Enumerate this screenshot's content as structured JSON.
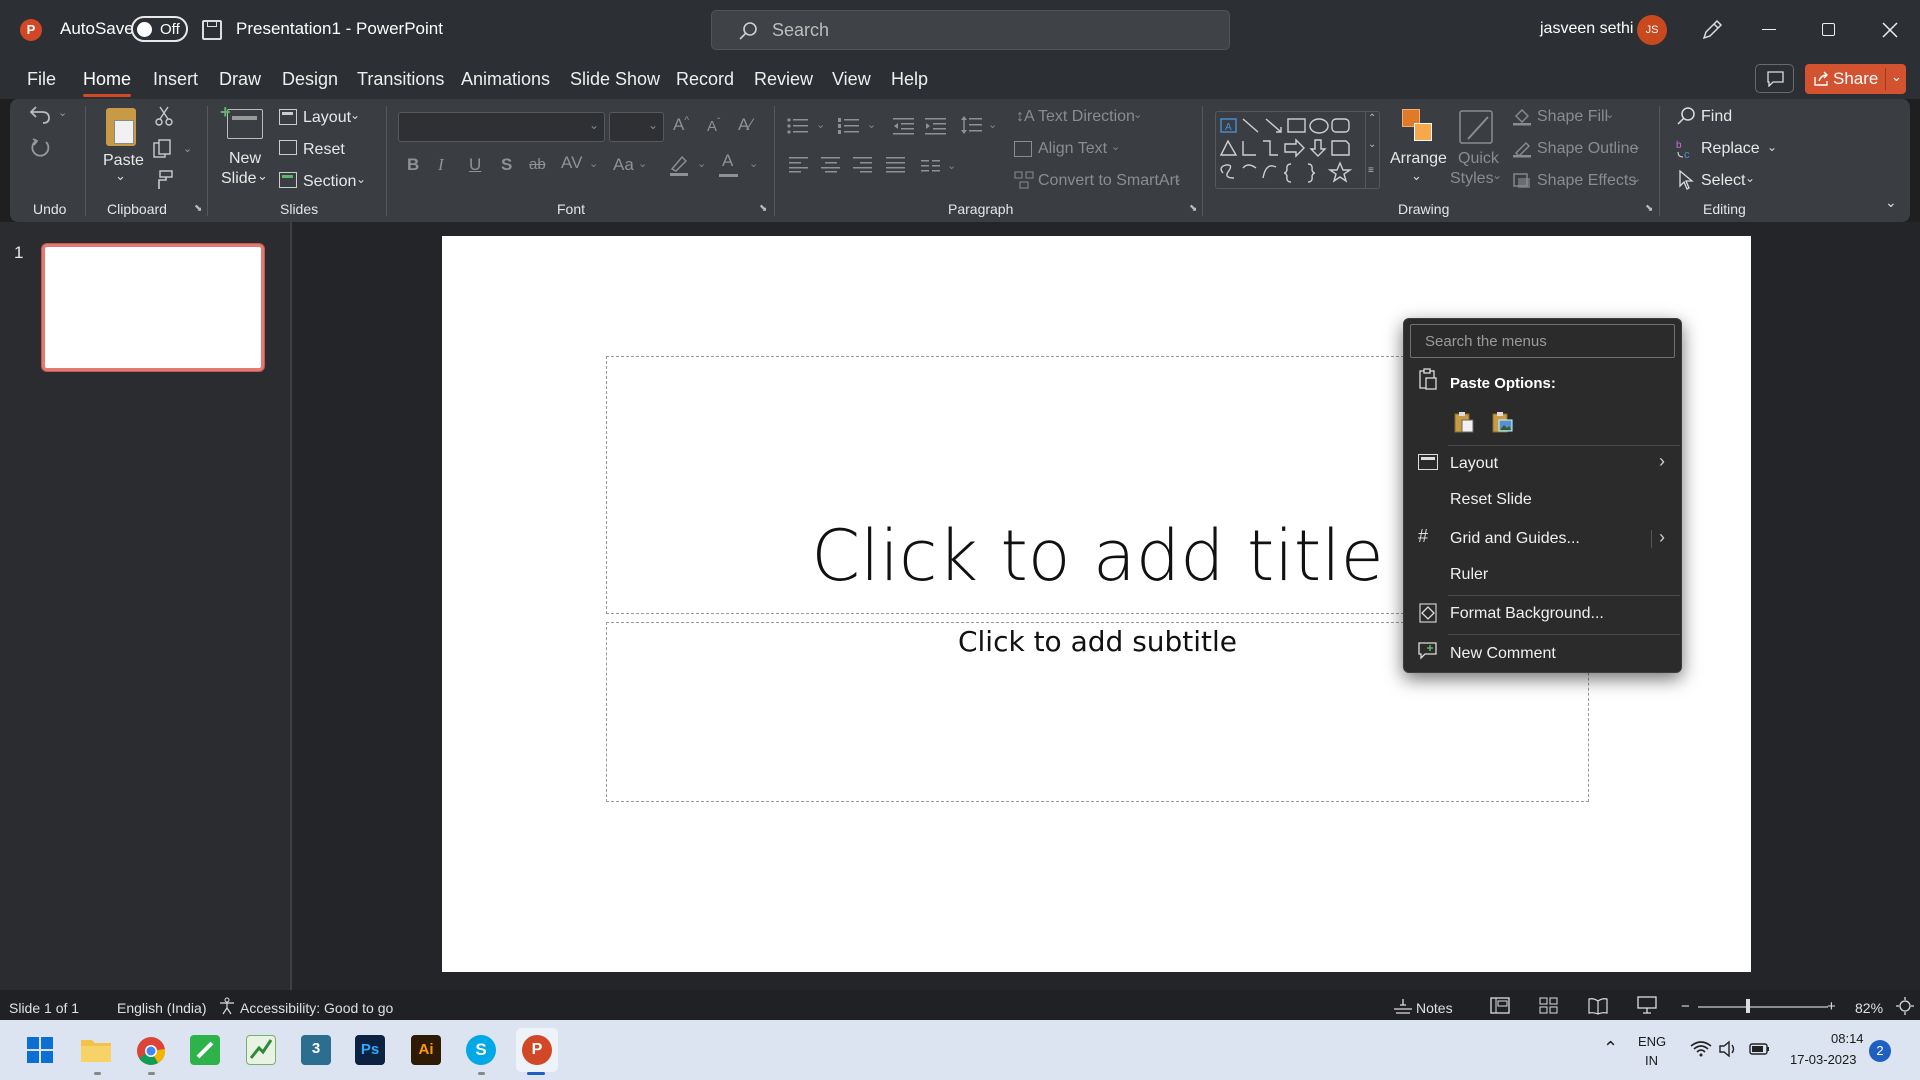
{
  "titlebar": {
    "autosave_label": "AutoSave",
    "autosave_state": "Off",
    "doc_title": "Presentation1  -  PowerPoint",
    "search_placeholder": "Search",
    "user_name": "jasveen sethi",
    "user_initials": "JS"
  },
  "menu": {
    "tabs": [
      "File",
      "Home",
      "Insert",
      "Draw",
      "Design",
      "Transitions",
      "Animations",
      "Slide Show",
      "Record",
      "Review",
      "View",
      "Help"
    ],
    "active_tab": "Home",
    "share_label": "Share"
  },
  "ribbon": {
    "groups": {
      "undo": "Undo",
      "clipboard": "Clipboard",
      "slides": "Slides",
      "font": "Font",
      "paragraph": "Paragraph",
      "drawing": "Drawing",
      "editing": "Editing"
    },
    "paste_label": "Paste",
    "new_slide_label_1": "New",
    "new_slide_label_2": "Slide",
    "layout_label": "Layout",
    "reset_label": "Reset",
    "section_label": "Section",
    "text_direction_label": "Text Direction",
    "align_text_label": "Align Text",
    "convert_smartart_label": "Convert to SmartArt",
    "arrange_label": "Arrange",
    "quick_styles_label_1": "Quick",
    "quick_styles_label_2": "Styles",
    "shape_fill_label": "Shape Fill",
    "shape_outline_label": "Shape Outline",
    "shape_effects_label": "Shape Effects",
    "find_label": "Find",
    "replace_label": "Replace",
    "select_label": "Select",
    "font_buttons": [
      "B",
      "I",
      "U",
      "S",
      "ab",
      "AV",
      "Aa"
    ]
  },
  "slides_pane": {
    "slide_number": "1"
  },
  "slide": {
    "title_placeholder": "Click to add title",
    "subtitle_placeholder": "Click to add subtitle"
  },
  "context_menu": {
    "search_placeholder": "Search the menus",
    "paste_options_label": "Paste Options:",
    "items": [
      "Layout",
      "Reset Slide",
      "Grid and Guides...",
      "Ruler",
      "Format Background...",
      "New Comment"
    ]
  },
  "statusbar": {
    "slide_count": "Slide 1 of 1",
    "language": "English (India)",
    "accessibility": "Accessibility: Good to go",
    "notes_label": "Notes",
    "zoom": "82%"
  },
  "taskbar": {
    "lang_1": "ENG",
    "lang_2": "IN",
    "time": "08:14",
    "date": "17-03-2023",
    "notification_count": "2",
    "app_labels": [
      "Ps",
      "Ai",
      "S"
    ]
  }
}
